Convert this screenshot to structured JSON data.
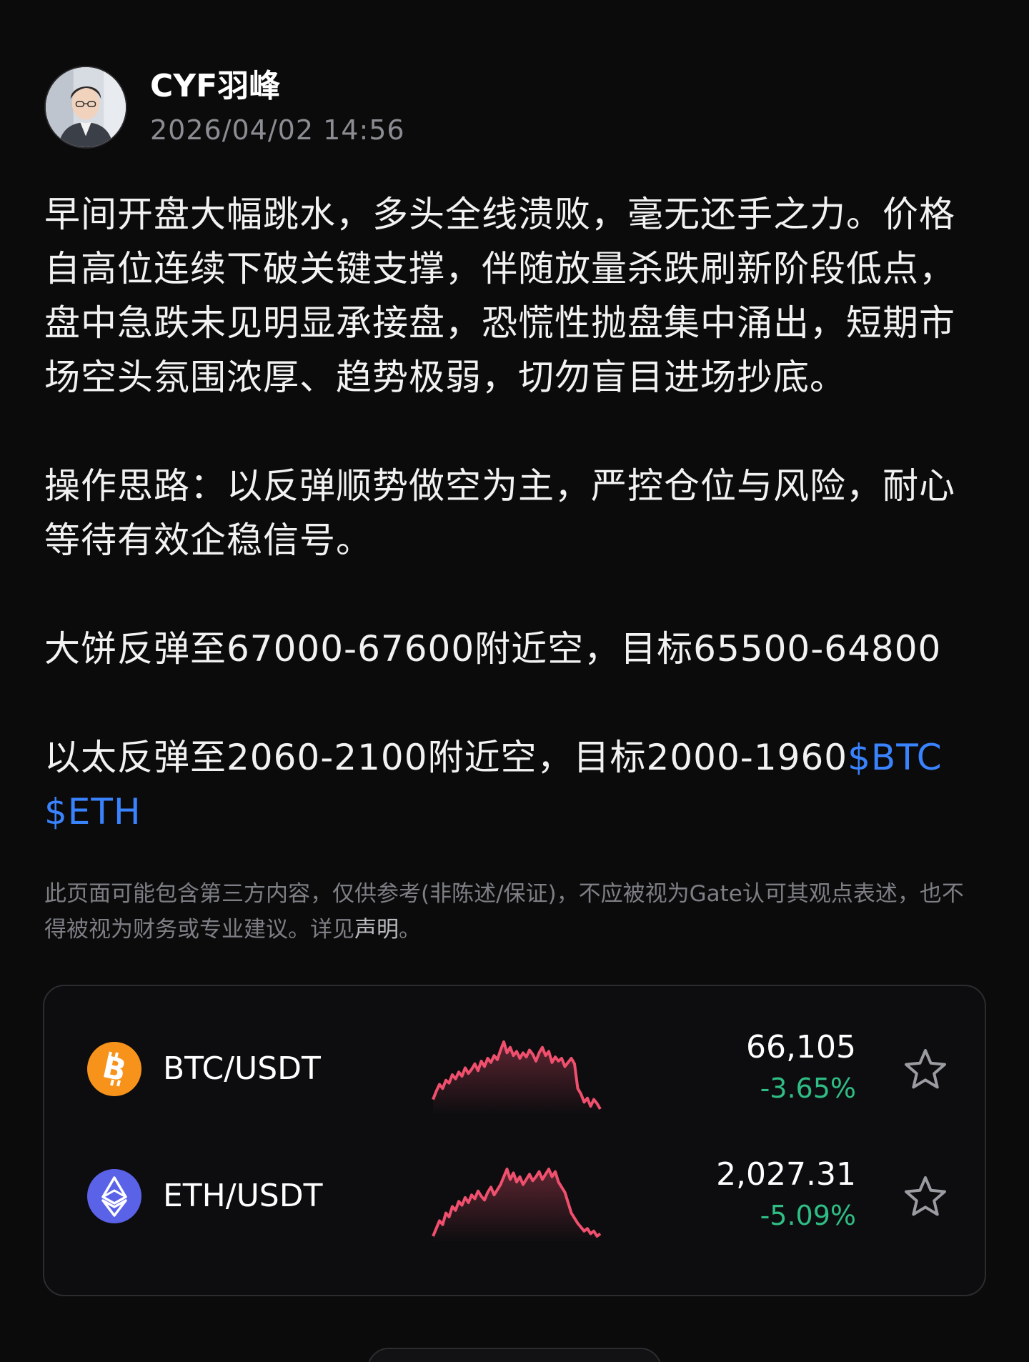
{
  "author": {
    "name": "CYF羽峰",
    "timestamp": "2026/04/02 14:56",
    "avatar_icon": "avatar-portrait"
  },
  "post": {
    "paragraph_1": "早间开盘大幅跳水，多头全线溃败，毫无还手之力。价格自高位连续下破关键支撑，伴随放量杀跌刷新阶段低点，盘中急跌未见明显承接盘，恐慌性抛盘集中涌出，短期市场空头氛围浓厚、趋势极弱，切勿盲目进场抄底。",
    "paragraph_2": "操作思路：以反弹顺势做空为主，严控仓位与风险，耐心等待有效企稳信号。",
    "paragraph_3": "大饼反弹至67000-67600附近空，目标65500-64800",
    "paragraph_4_text": "以太反弹至2060-2100附近空，目标2000-1960",
    "tag_btc": "$BTC",
    "tag_eth": "$ETH",
    "link_color": "#3a83ff"
  },
  "disclaimer": {
    "text": "此页面可能包含第三方内容，仅供参考(非陈述/保证)，不应被视为Gate认可其观点表述，也不得被视为财务或专业建议。详见",
    "link": "声明",
    "end": "。"
  },
  "markets": [
    {
      "pair": "BTC/USDT",
      "price": "66,105",
      "change": "-3.65%",
      "change_color": "#2fbd85",
      "icon": "bitcoin-icon",
      "icon_color": "#f7931a",
      "sparkline_color": "#f0506e",
      "sparkline": [
        52,
        58,
        63,
        60,
        66,
        64,
        70,
        67,
        72,
        69,
        75,
        71,
        74,
        78,
        73,
        80,
        76,
        82,
        79,
        84,
        81,
        88,
        94,
        86,
        90,
        84,
        87,
        82,
        86,
        83,
        88,
        85,
        80,
        86,
        90,
        84,
        87,
        79,
        83,
        80,
        82,
        76,
        79,
        82,
        78,
        60,
        56,
        50,
        53,
        47,
        52,
        49,
        45
      ]
    },
    {
      "pair": "ETH/USDT",
      "price": "2,027.31",
      "change": "-5.09%",
      "change_color": "#2fbd85",
      "icon": "ethereum-icon",
      "icon_color": "#5a63e8",
      "sparkline_color": "#f0506e",
      "sparkline": [
        40,
        46,
        52,
        49,
        58,
        55,
        63,
        60,
        67,
        64,
        70,
        66,
        72,
        69,
        75,
        71,
        68,
        74,
        78,
        72,
        76,
        80,
        86,
        92,
        84,
        89,
        82,
        86,
        80,
        84,
        88,
        83,
        86,
        90,
        84,
        88,
        92,
        86,
        90,
        82,
        78,
        74,
        66,
        58,
        54,
        50,
        47,
        44,
        46,
        42,
        44,
        40,
        42
      ]
    }
  ]
}
